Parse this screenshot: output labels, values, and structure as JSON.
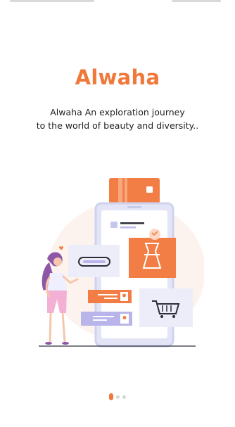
{
  "app": {
    "title": "Alwaha",
    "tagline_line1": "Alwaha An exploration journey",
    "tagline_line2": "to the world of beauty and diversity.."
  },
  "illustration": {
    "icons": [
      "credit-card-icon",
      "smartphone-icon",
      "dress-icon",
      "shopping-cart-icon",
      "person-icon"
    ]
  },
  "pager": {
    "total": 3,
    "active_index": 0
  },
  "colors": {
    "accent": "#f0783a",
    "text": "#1f1f1f",
    "lavender": "#b9b5ea",
    "dot_inactive": "#d6d6d6"
  }
}
